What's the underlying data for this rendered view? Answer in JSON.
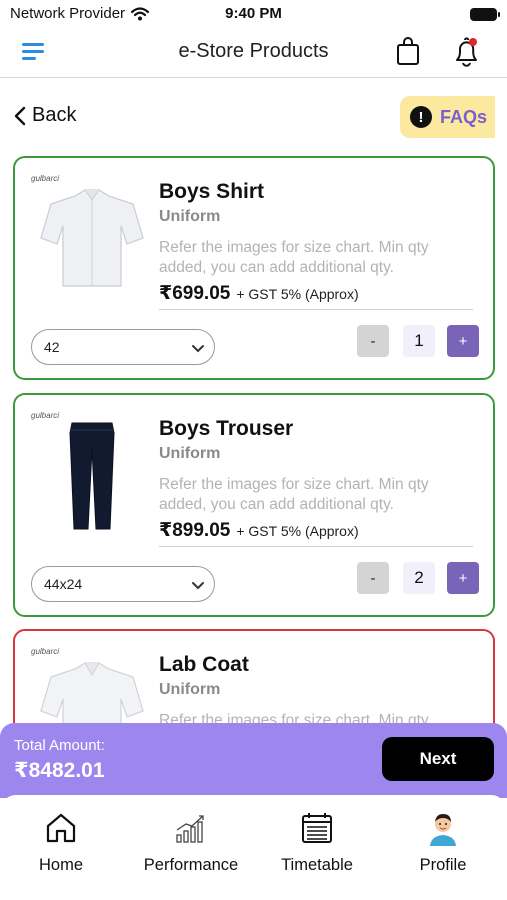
{
  "status_bar": {
    "carrier": "Network Provider",
    "time": "9:40 PM"
  },
  "header": {
    "title": "e-Store Products"
  },
  "back": {
    "label": "Back"
  },
  "faq": {
    "badge": "!",
    "label": "FAQs"
  },
  "products": [
    {
      "name": "Boys Shirt",
      "category": "Uniform",
      "description": "Refer the images for size chart. Min qty added, you can add additional qty.",
      "price": "₹699.05",
      "tax": "+ GST 5% (Approx)",
      "size": "42",
      "quantity": "1",
      "minus": "-",
      "plus": "+",
      "border_color": "#3b9a3b"
    },
    {
      "name": "Boys Trouser",
      "category": "Uniform",
      "description": "Refer the images for size chart. Min qty added, you can add additional qty.",
      "price": "₹899.05",
      "tax": "+ GST 5% (Approx)",
      "size": "44x24",
      "quantity": "2",
      "minus": "-",
      "plus": "+",
      "border_color": "#3b9a3b"
    },
    {
      "name": "Lab Coat",
      "category": "Uniform",
      "description": "Refer the images for size chart. Min qty",
      "border_color": "#d9363e"
    }
  ],
  "total": {
    "label": "Total Amount:",
    "amount": "₹8482.01",
    "next_label": "Next"
  },
  "nav": [
    {
      "label": "Home",
      "icon": "home-icon"
    },
    {
      "label": "Performance",
      "icon": "performance-icon"
    },
    {
      "label": "Timetable",
      "icon": "timetable-icon"
    },
    {
      "label": "Profile",
      "icon": "profile-avatar"
    }
  ],
  "colors": {
    "accent": "#7a64b8",
    "menu": "#2d8be0",
    "faq_bg": "#fbe9a0",
    "total_bg": "#9d87ee"
  }
}
